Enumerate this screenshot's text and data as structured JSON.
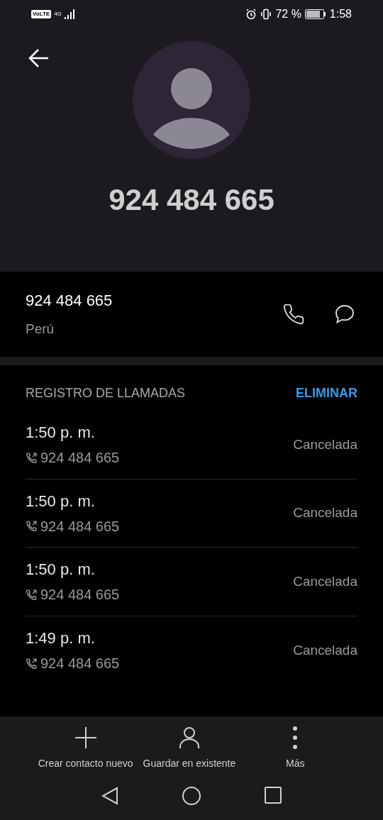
{
  "status_bar": {
    "volte": "VoLTE",
    "network": "4G",
    "battery": "72 %",
    "time": "1:58"
  },
  "header": {
    "number": "924 484 665"
  },
  "contact_info": {
    "number": "924 484 665",
    "country": "Perú"
  },
  "call_log": {
    "title": "REGISTRO DE LLAMADAS",
    "action": "ELIMINAR",
    "calls": [
      {
        "time": "1:50 p. m.",
        "number": "924 484 665",
        "status": "Cancelada"
      },
      {
        "time": "1:50 p. m.",
        "number": "924 484 665",
        "status": "Cancelada"
      },
      {
        "time": "1:50 p. m.",
        "number": "924 484 665",
        "status": "Cancelada"
      },
      {
        "time": "1:49 p. m.",
        "number": "924 484 665",
        "status": "Cancelada"
      }
    ]
  },
  "actions": [
    {
      "kind": "add",
      "label": "Crear contacto nuevo"
    },
    {
      "kind": "person",
      "label": "Guardar en existente"
    },
    {
      "kind": "more",
      "label": "Más"
    }
  ]
}
